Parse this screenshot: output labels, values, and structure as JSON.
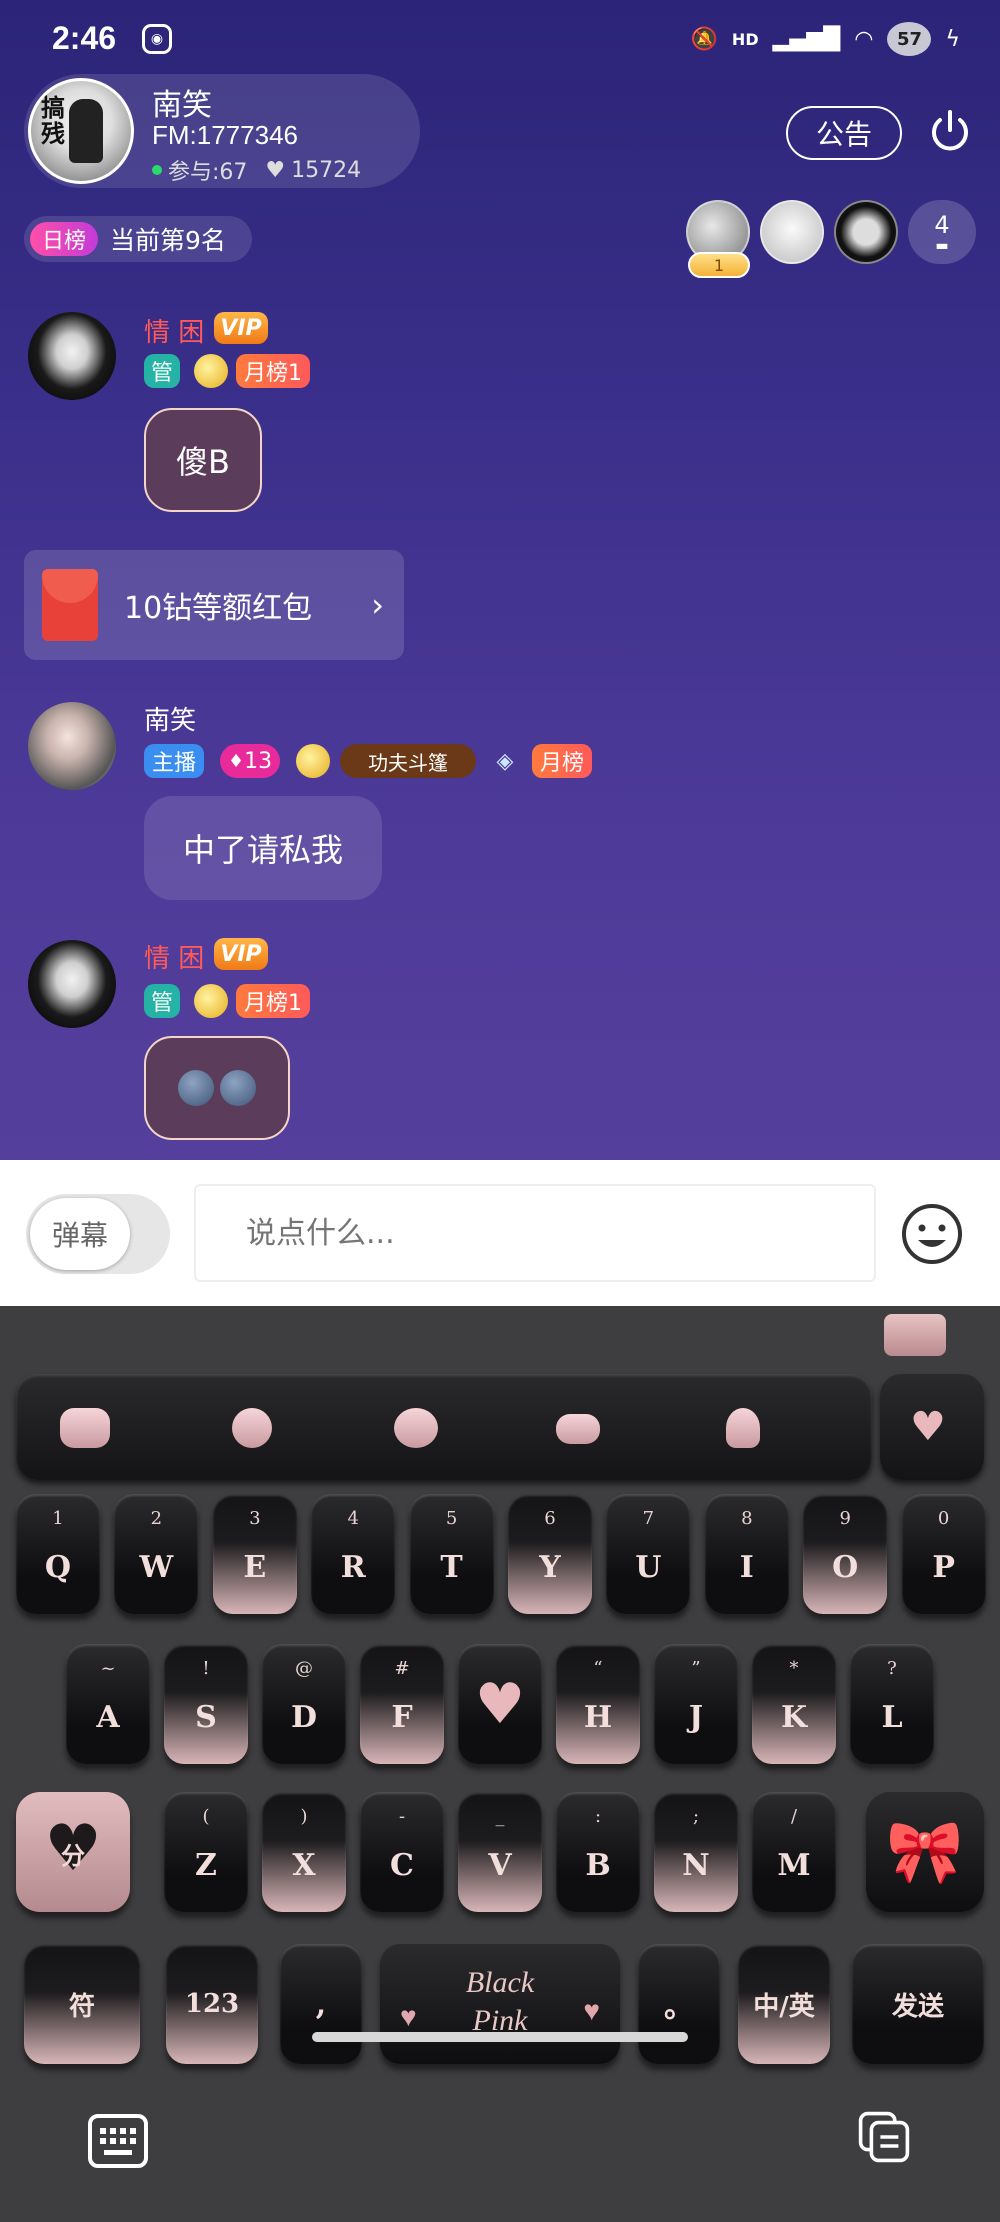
{
  "status_bar": {
    "time": "2:46",
    "app_icon": "weibo-icon",
    "network": "HD",
    "battery": "57"
  },
  "host": {
    "name": "南笑",
    "fm": "FM:1777346",
    "participants": "参与:67",
    "likes": "15724",
    "avatar_chars": "搞残"
  },
  "header": {
    "notice_label": "公告",
    "power_icon": "power-icon"
  },
  "rank": {
    "badge": "日榜",
    "text": "当前第9名"
  },
  "audience": {
    "rank_badge": "1",
    "count": "4"
  },
  "messages": [
    {
      "user": "情 困",
      "vip": "VIP",
      "badges": [
        "管",
        "月榜1"
      ],
      "text": "傻B"
    },
    {
      "redpacket": "10钻等额红包"
    },
    {
      "user": "南笑",
      "badges": [
        "主播",
        "13",
        "功夫斗篷",
        "月榜"
      ],
      "text": "中了请私我"
    },
    {
      "user": "情 困",
      "vip": "VIP",
      "badges": [
        "管",
        "月榜1"
      ],
      "text": ""
    }
  ],
  "input_bar": {
    "danmu_label": "弹幕",
    "placeholder": "说点什么..."
  },
  "keyboard": {
    "row1": [
      {
        "sym": "1",
        "ltr": "Q"
      },
      {
        "sym": "2",
        "ltr": "W"
      },
      {
        "sym": "3",
        "ltr": "E"
      },
      {
        "sym": "4",
        "ltr": "R"
      },
      {
        "sym": "5",
        "ltr": "T"
      },
      {
        "sym": "6",
        "ltr": "Y"
      },
      {
        "sym": "7",
        "ltr": "U"
      },
      {
        "sym": "8",
        "ltr": "I"
      },
      {
        "sym": "9",
        "ltr": "O"
      },
      {
        "sym": "0",
        "ltr": "P"
      }
    ],
    "row2": [
      {
        "sym": "~",
        "ltr": "A"
      },
      {
        "sym": "!",
        "ltr": "S"
      },
      {
        "sym": "@",
        "ltr": "D"
      },
      {
        "sym": "#",
        "ltr": "F"
      },
      {
        "sym": "“",
        "ltr": "H"
      },
      {
        "sym": "”",
        "ltr": "J"
      },
      {
        "sym": "*",
        "ltr": "K"
      },
      {
        "sym": "?",
        "ltr": "L"
      }
    ],
    "row3": [
      {
        "sym": "(",
        "ltr": "Z"
      },
      {
        "sym": ")",
        "ltr": "X"
      },
      {
        "sym": "-",
        "ltr": "C"
      },
      {
        "sym": "_",
        "ltr": "V"
      },
      {
        "sym": ":",
        "ltr": "B"
      },
      {
        "sym": ";",
        "ltr": "N"
      },
      {
        "sym": "/",
        "ltr": "M"
      }
    ],
    "fen_label": "分",
    "fu_label": "符",
    "num_label": "123",
    "comma_label": ",",
    "space_line1": "Black",
    "space_line2": "Pink",
    "period_label": "。",
    "lang_label": "中/英",
    "send_label": "发送"
  }
}
